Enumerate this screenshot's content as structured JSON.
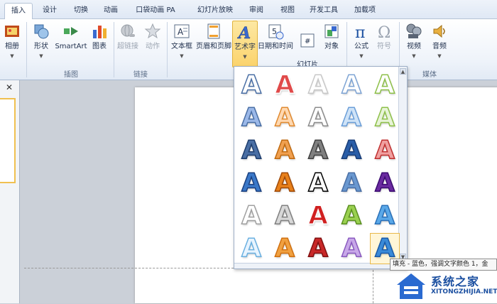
{
  "tabs": [
    {
      "label": "插入",
      "active": true
    },
    {
      "label": "设计"
    },
    {
      "label": "切换"
    },
    {
      "label": "动画"
    },
    {
      "label": "口袋动画 PA"
    },
    {
      "label": "幻灯片放映"
    },
    {
      "label": "审阅"
    },
    {
      "label": "视图"
    },
    {
      "label": "开发工具"
    },
    {
      "label": "加载项"
    }
  ],
  "ribbon": {
    "buttons": {
      "album": "相册",
      "shapes": "形状",
      "smartart": "SmartArt",
      "chart": "图表",
      "hyperlink": "超链接",
      "action": "动作",
      "textbox": "文本框",
      "header_footer": "页眉和页脚",
      "wordart": "艺术字",
      "date_time": "日期和时间",
      "slide_number": "幻灯片\n编号",
      "object": "对象",
      "equation": "公式",
      "symbol": "符号",
      "video": "视频",
      "audio": "音频"
    },
    "groups": {
      "illustrations": "插图",
      "links": "链接",
      "media": "媒体"
    }
  },
  "gallery": {
    "glyph": "A",
    "styles": [
      [
        "#ffffff|#4a6fa5",
        "#e04a4a|#ffffff",
        "#ffffff|#c8c8c8",
        "#ffffff|#7ea4d4",
        "#ffffff|#8ec04a"
      ],
      [
        "#9bb8e8|#4a6fa5",
        "#ffd8b0|#e08a30",
        "#ffffff|#8c8c8c",
        "#cfe3f7|#6a9ed8",
        "#e8f4d8|#8ec04a"
      ],
      [
        "#4a6fa5|#1f3e6e",
        "#f0a050|#c06a10",
        "#808080|#404040",
        "#2a5ea8|#1a3e78",
        "#f0a0a0|#c03030"
      ],
      [
        "#3a78c8|#1a4080",
        "#e8801a|#a04a08",
        "#ffffff|#000000",
        "#6a98d0|#4a6fa5",
        "#6a2aa0|#3a0a70"
      ],
      [
        "#ffffff|#a0a0a0",
        "#d8d8d8|#808080",
        "#d02020|#ffffff",
        "#9ad050|#5a9020",
        "#5aa8e8|#2a70b8"
      ],
      [
        "#e8f4ff|#6ab0e0",
        "#f0a040|#d07010",
        "#c82828|#801010",
        "#c8a8e8|#8a5ac0",
        "#3a8ad8|#1a5aa8"
      ]
    ],
    "selected": [
      5,
      4
    ]
  },
  "tooltip": "填充 - 蓝色，强调文字颜色 1，金",
  "watermark": {
    "name": "系统之家",
    "url": "XITONGZHIJIA.NET"
  }
}
